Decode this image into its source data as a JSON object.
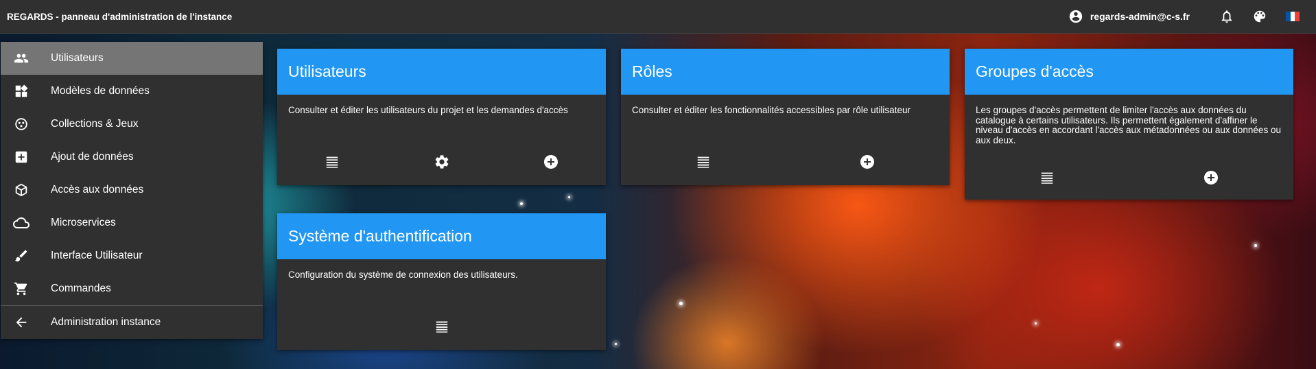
{
  "app": {
    "title": "REGARDS - panneau d'administration de l'instance",
    "user_email": "regards-admin@c-s.fr",
    "icons": [
      "account-circle-icon",
      "bell-icon",
      "palette-icon",
      "flag-fr-icon"
    ],
    "flag_colors": [
      "#0055a4",
      "#ffffff",
      "#ef4135"
    ]
  },
  "sidebar": {
    "items": [
      {
        "label": "Utilisateurs",
        "icon": "users-icon",
        "active": true
      },
      {
        "label": "Modèles de données",
        "icon": "widgets-icon"
      },
      {
        "label": "Collections & Jeux",
        "icon": "bubbles-icon"
      },
      {
        "label": "Ajout de données",
        "icon": "add-box-icon"
      },
      {
        "label": "Accès aux données",
        "icon": "cube-icon"
      },
      {
        "label": "Microservices",
        "icon": "cloud-icon"
      },
      {
        "label": "Interface Utilisateur",
        "icon": "brush-icon"
      },
      {
        "label": "Commandes",
        "icon": "cart-icon"
      }
    ],
    "back_item": {
      "label": "Administration instance",
      "icon": "arrow-back-icon"
    }
  },
  "cards": [
    {
      "title": "Utilisateurs",
      "description": "Consulter et éditer les utilisateurs du projet et les demandes d'accès",
      "actions": [
        "list-icon",
        "gear-icon",
        "add-circle-icon"
      ]
    },
    {
      "title": "Rôles",
      "description": "Consulter et éditer les fonctionnalités accessibles par rôle utilisateur",
      "actions": [
        "list-icon",
        "add-circle-icon"
      ]
    },
    {
      "title": "Groupes d'accès",
      "description": "Les groupes d'accès permettent de limiter l'accès aux données du catalogue à certains utilisateurs. Ils permettent également d'affiner le niveau d'accès en accordant l'accès aux métadonnées ou aux données ou aux deux.",
      "actions": [
        "list-icon",
        "add-circle-icon"
      ]
    },
    {
      "title": "Système d'authentification",
      "description": "Configuration du système de connexion des utilisateurs.",
      "actions": [
        "list-icon"
      ]
    }
  ],
  "colors": {
    "accent": "#2196f3",
    "surface": "#303030",
    "active_item": "#757575"
  }
}
